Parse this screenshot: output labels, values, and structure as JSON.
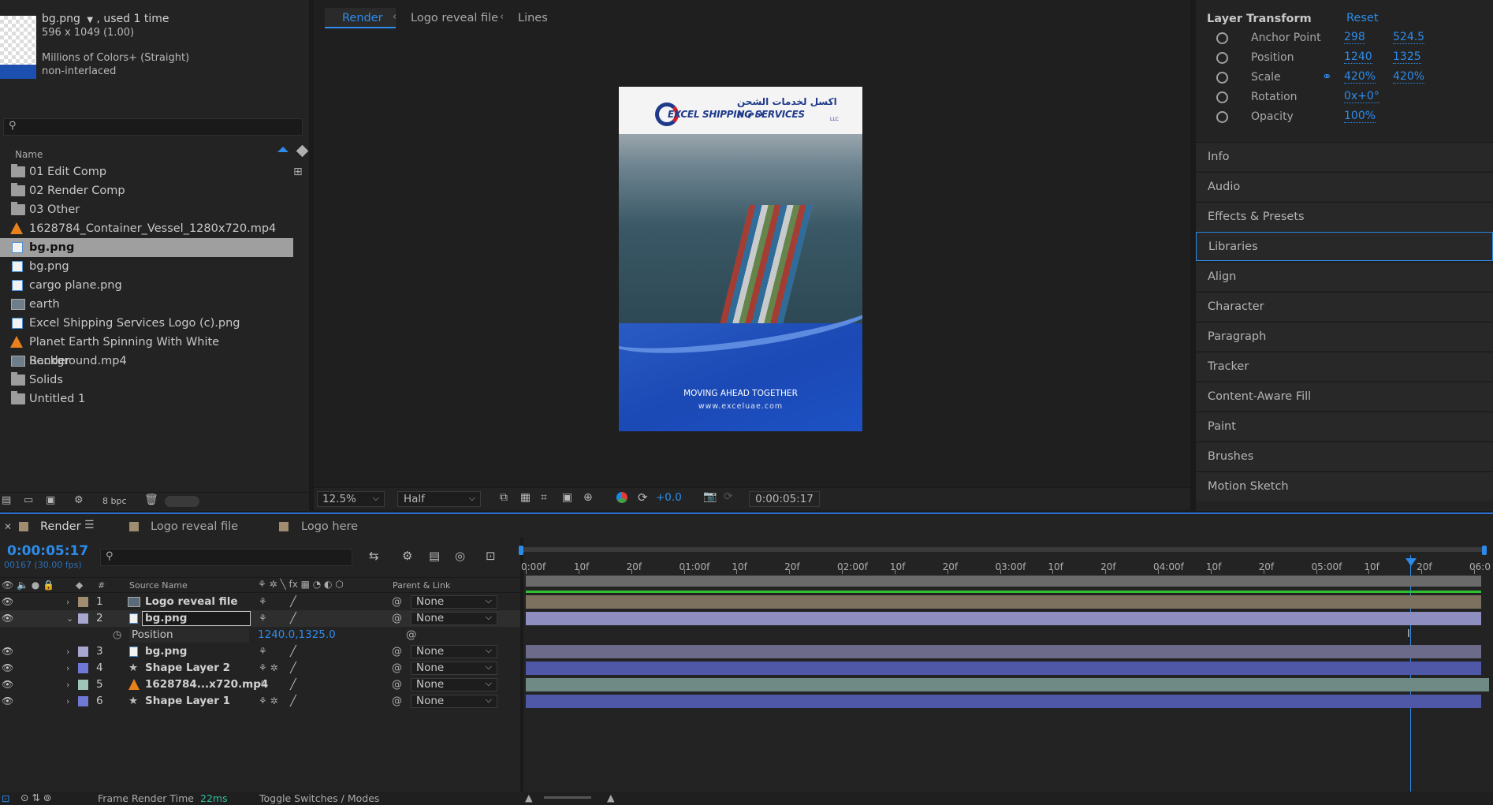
{
  "project": {
    "file_name": "bg.png",
    "used": ", used 1 time",
    "dims": "596 x 1049 (1.00)",
    "color": "Millions of Colors+ (Straight)",
    "interlace": "non-interlaced",
    "col_name": "Name",
    "items": [
      {
        "label": "01 Edit Comp",
        "icon": "folder"
      },
      {
        "label": "02 Render Comp",
        "icon": "folder"
      },
      {
        "label": "03 Other",
        "icon": "folder"
      },
      {
        "label": "1628784_Container_Vessel_1280x720.mp4",
        "icon": "video"
      },
      {
        "label": "bg.png",
        "icon": "image"
      },
      {
        "label": "bg.png",
        "icon": "image"
      },
      {
        "label": "cargo plane.png",
        "icon": "image"
      },
      {
        "label": "earth",
        "icon": "composition"
      },
      {
        "label": "Excel Shipping Services Logo (c).png",
        "icon": "image"
      },
      {
        "label": "Planet Earth Spinning With White Background.mp4",
        "icon": "video"
      },
      {
        "label": "Render",
        "icon": "composition"
      },
      {
        "label": "Solids",
        "icon": "folder"
      },
      {
        "label": "Untitled 1",
        "icon": "folder"
      }
    ],
    "bpc": "8 bpc"
  },
  "viewer": {
    "tabs": [
      "Render",
      "Logo reveal file",
      "Lines"
    ],
    "zoom": "12.5%",
    "resolution": "Half",
    "exposure": "+0.0",
    "timecode": "0:00:05:17",
    "poster": {
      "arabic": "اكسل لخدمات الشحن ذ.م.م",
      "brand": "EXCEL SHIPPING SERVICES",
      "llc": "LLC",
      "tagline": "MOVING AHEAD TOGETHER",
      "url": "www.exceluae.com"
    }
  },
  "layer_transform": {
    "title": "Layer Transform",
    "reset": "Reset",
    "rows": [
      {
        "name": "Anchor Point",
        "v1": "298",
        "v2": "524.5"
      },
      {
        "name": "Position",
        "v1": "1240",
        "v2": "1325"
      },
      {
        "name": "Scale",
        "v1": "420%",
        "v2": "420%"
      },
      {
        "name": "Rotation",
        "v1": "0x+0°",
        "v2": ""
      },
      {
        "name": "Opacity",
        "v1": "100%",
        "v2": ""
      }
    ]
  },
  "panels": [
    "Info",
    "Audio",
    "Effects & Presets",
    "Libraries",
    "Align",
    "Character",
    "Paragraph",
    "Tracker",
    "Content-Aware Fill",
    "Paint",
    "Brushes",
    "Motion Sketch"
  ],
  "timeline": {
    "tabs": [
      "Render",
      "Logo reveal file",
      "Logo here"
    ],
    "timecode": "0:00:05:17",
    "frames": "00167 (30.00 fps)",
    "col_source": "Source Name",
    "col_num": "#",
    "col_parent": "Parent & Link",
    "layers": [
      {
        "num": "1",
        "name": "Logo reveal file",
        "parent": "None",
        "label_color": "#a08c6e"
      },
      {
        "num": "2",
        "name": "bg.png",
        "parent": "None",
        "label_color": "#a7a7d0"
      },
      {
        "num": "3",
        "name": "bg.png",
        "parent": "None",
        "label_color": "#a7a7d0"
      },
      {
        "num": "4",
        "name": "Shape Layer 2",
        "parent": "None",
        "label_color": "#6f78d6"
      },
      {
        "num": "5",
        "name": "1628784...x720.mp4",
        "parent": "None",
        "label_color": "#9fc4b8"
      },
      {
        "num": "6",
        "name": "Shape Layer 1",
        "parent": "None",
        "label_color": "#6f78d6"
      }
    ],
    "position_label": "Position",
    "position_value": "1240.0,1325.0",
    "ruler": [
      "0:00f",
      "10f",
      "20f",
      "01:00f",
      "10f",
      "20f",
      "02:00f",
      "10f",
      "20f",
      "03:00f",
      "10f",
      "20f",
      "04:00f",
      "10f",
      "20f",
      "05:00f",
      "10f",
      "20f",
      "06:0"
    ],
    "frame_render_label": "Frame Render Time",
    "frame_render_value": "22ms",
    "toggle_label": "Toggle Switches / Modes"
  }
}
